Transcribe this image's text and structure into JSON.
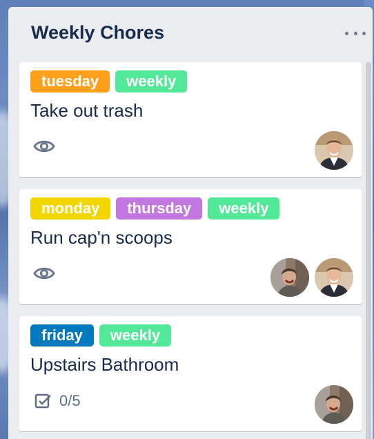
{
  "colors": {
    "tuesday": "#ff9f1a",
    "weekly": "#51e898",
    "monday": "#f2d600",
    "thursday": "#c377e0",
    "friday": "#0079bf"
  },
  "list": {
    "title": "Weekly Chores",
    "menu_icon": "more-horizontal-icon"
  },
  "cards": [
    {
      "labels": [
        "tuesday",
        "weekly"
      ],
      "title": "Take out trash",
      "badge_icon": "eye-icon",
      "members": [
        "man-avatar"
      ]
    },
    {
      "labels": [
        "monday",
        "thursday",
        "weekly"
      ],
      "title": "Run cap'n scoops",
      "badge_icon": "eye-icon",
      "members": [
        "woman-avatar",
        "man-avatar"
      ]
    },
    {
      "labels": [
        "friday",
        "weekly"
      ],
      "title": "Upstairs Bathroom",
      "badge_icon": "checklist-icon",
      "checklist": "0/5",
      "members": [
        "woman-avatar"
      ]
    }
  ]
}
